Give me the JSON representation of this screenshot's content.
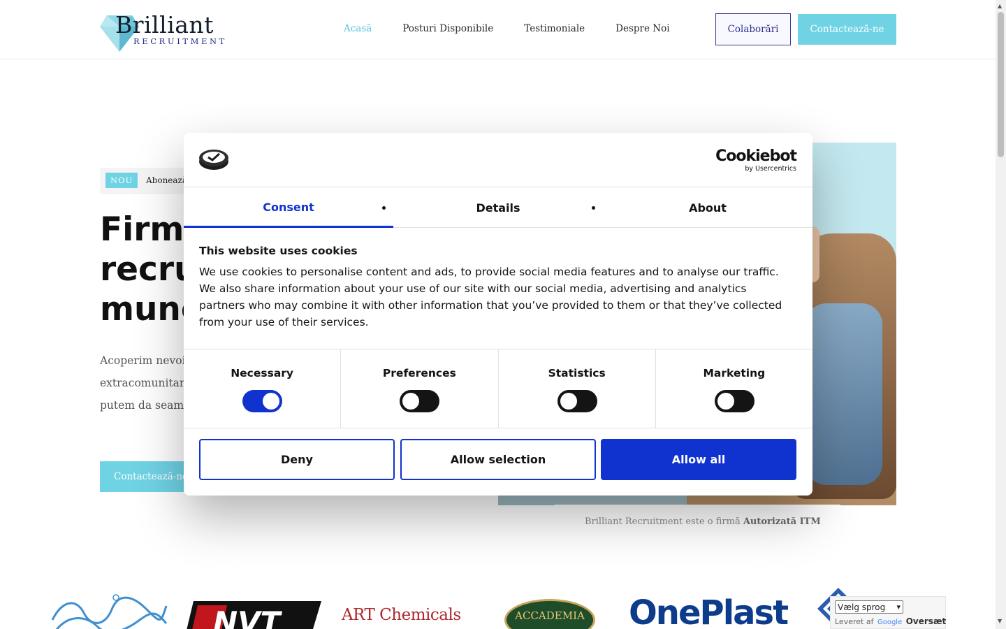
{
  "header": {
    "logo_main": "Brilliant",
    "logo_sub": "RECRUITMENT",
    "nav": [
      {
        "label": "Acasă",
        "active": true
      },
      {
        "label": "Posturi Disponibile"
      },
      {
        "label": "Testimoniale"
      },
      {
        "label": "Despre Noi"
      }
    ],
    "btn_collab": "Colaborări",
    "btn_contact": "Contactează-ne"
  },
  "hero": {
    "badge": "NOU",
    "badge_text": "Abonează",
    "title_lines": [
      "Firmă",
      "recrut",
      "munc"
    ],
    "paragraph_lines": [
      "Acoperim nevoil",
      "extracomunitar,",
      "putem da seama"
    ],
    "button": "Contactează-ne",
    "caption_prefix": "Brilliant Recruitment este o firmă ",
    "caption_bold": "Autorizată ITM"
  },
  "clients": {
    "art_chemicals": "ART Chemicals",
    "accademia": "ACCADEMIA",
    "oneplast": "OnePlast",
    "nvt": "NVT"
  },
  "cookie": {
    "brand": "Cookiebot",
    "brand_sub": "by Usercentrics",
    "tabs": [
      "Consent",
      "Details",
      "About"
    ],
    "heading": "This website uses cookies",
    "text": "We use cookies to personalise content and ads, to provide social media features and to analyse our traffic. We also share information about your use of our site with our social media, advertising and analytics partners who may combine it with other information that you’ve provided to them or that they’ve collected from your use of their services.",
    "categories": [
      {
        "label": "Necessary",
        "on": true
      },
      {
        "label": "Preferences",
        "on": false
      },
      {
        "label": "Statistics",
        "on": false
      },
      {
        "label": "Marketing",
        "on": false
      }
    ],
    "buttons": {
      "deny": "Deny",
      "allow_selection": "Allow selection",
      "allow_all": "Allow all"
    },
    "accent": "#1032cf"
  },
  "translate": {
    "select": "Vælg sprog",
    "powered": "Leveret af",
    "google": "Google",
    "action": "Oversæt"
  },
  "colors": {
    "brand_cyan": "#6fd3e4",
    "navy": "#1e2a8a"
  }
}
